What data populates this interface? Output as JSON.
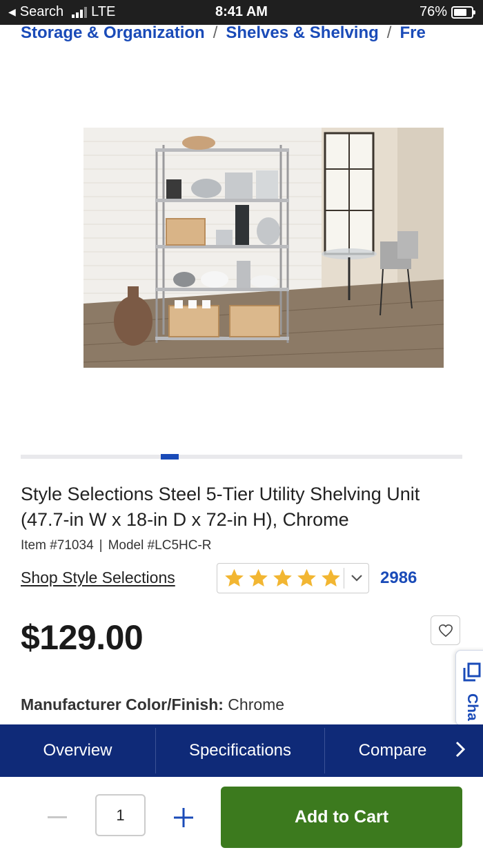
{
  "status_bar": {
    "back_label": "Search",
    "network": "LTE",
    "time": "8:41 AM",
    "battery_percent": "76%",
    "battery_level": 0.76
  },
  "breadcrumb": {
    "items": [
      "Storage & Organization",
      "Shelves & Shelving",
      "Fre"
    ],
    "separator": "/"
  },
  "product": {
    "image_icon": "product-photo",
    "title": "Style Selections Steel 5-Tier Utility Shelving Unit (47.7-in W x 18-in D x 72-in H), Chrome",
    "item_number": "Item #71034",
    "meta_separator": "|",
    "model_number": "Model #LC5HC-R",
    "brand_link": "Shop Style Selections",
    "rating_stars": 5,
    "review_count": "2986",
    "price": "$129.00",
    "color_label": "Manufacturer Color/Finish:",
    "color_value": "Chrome"
  },
  "carousel": {
    "active_index": 0
  },
  "chat": {
    "label": "Cha"
  },
  "tabs": {
    "items": [
      "Overview",
      "Specifications",
      "Compare"
    ]
  },
  "cart": {
    "quantity": "1",
    "add_label": "Add to Cart"
  },
  "colors": {
    "link_blue": "#1a4bb8",
    "nav_navy": "#0f2a78",
    "cart_green": "#3c7a1e",
    "star_gold": "#f2b632"
  }
}
